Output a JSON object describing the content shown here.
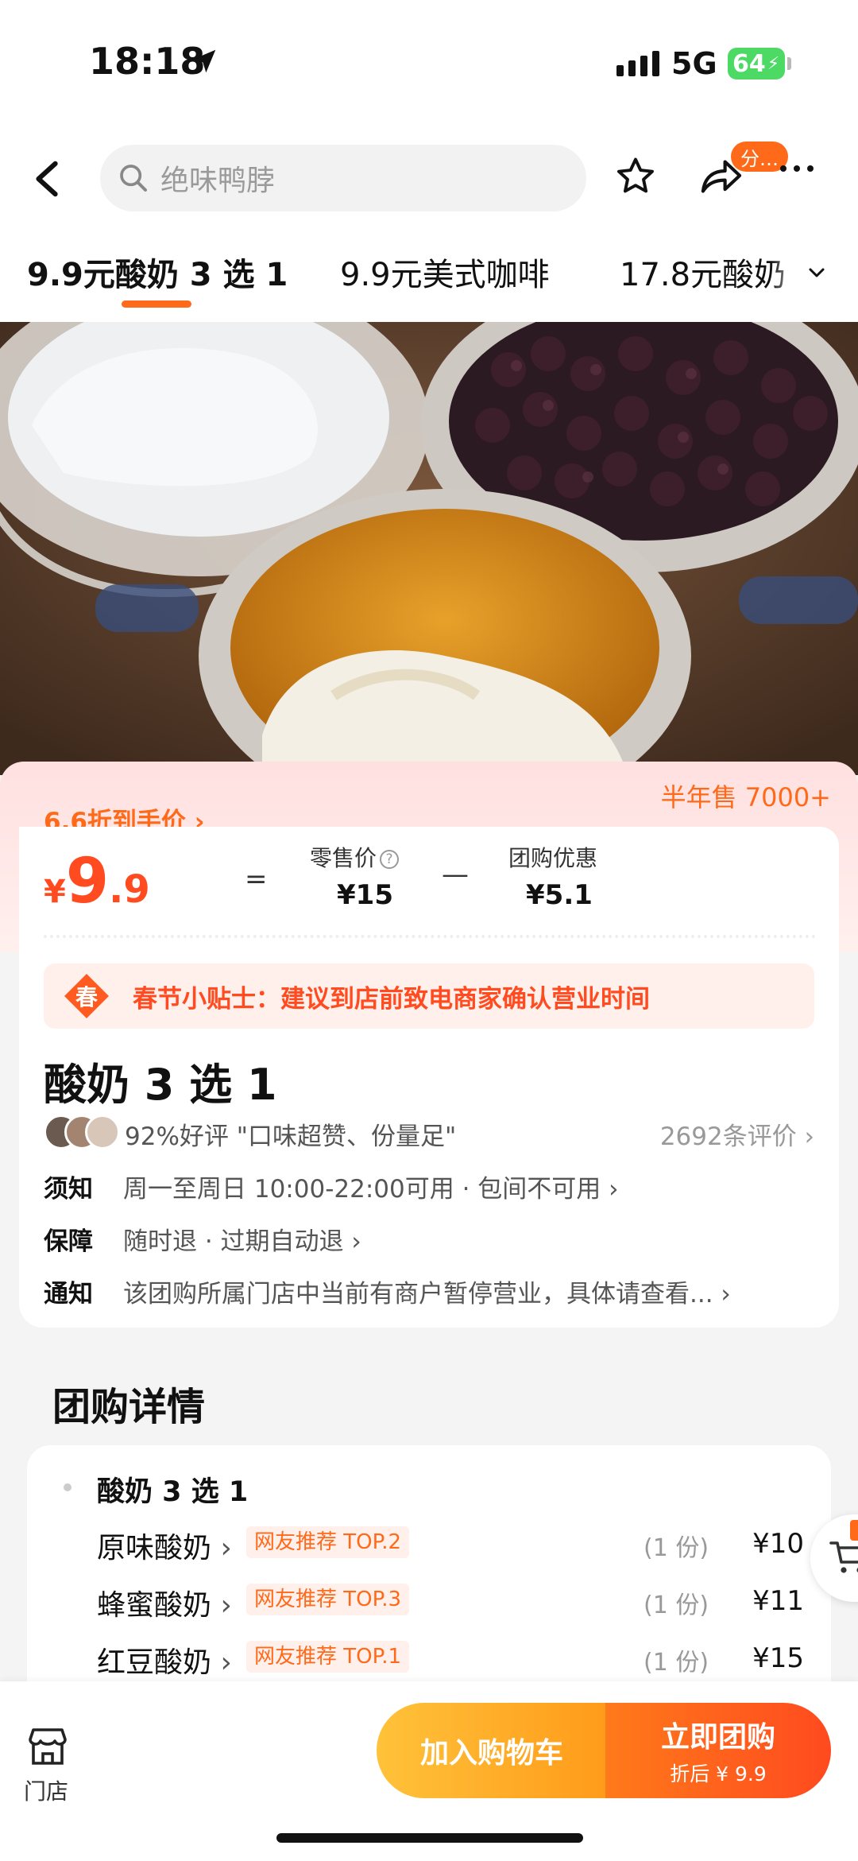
{
  "status": {
    "time": "18:18",
    "network": "5G",
    "battery": "64"
  },
  "header": {
    "search_placeholder": "绝味鸭脖",
    "share_badge": "分…"
  },
  "tabs": [
    {
      "label": "9.9元酸奶 3 选 1"
    },
    {
      "label": "9.9元美式咖啡"
    },
    {
      "label": "17.8元酸奶"
    }
  ],
  "price": {
    "discount_label": "6.6折到手价",
    "sales": "半年售 7000+",
    "currency": "¥",
    "integer": "9",
    "decimal": ".9",
    "equals": "=",
    "minus": "—",
    "retail_label": "零售价",
    "retail_value": "¥15",
    "group_label": "团购优惠",
    "group_value": "¥5.1"
  },
  "tip": {
    "badge": "春",
    "text": "春节小贴士：建议到店前致电商家确认营业时间"
  },
  "product": {
    "title": "酸奶 3 选 1"
  },
  "review": {
    "rating": "92%好评  \"口味超赞、份量足\"",
    "count": "2692条评价"
  },
  "info": [
    {
      "key": "须知",
      "value": "周一至周日 10:00-22:00可用 · 包间不可用"
    },
    {
      "key": "保障",
      "value": "随时退 · 过期自动退"
    },
    {
      "key": "通知",
      "value": "该团购所属门店中当前有商户暂停营业，具体请查看..."
    }
  ],
  "detail": {
    "heading": "团购详情",
    "group_name": "酸奶 3 选 1",
    "items": [
      {
        "name": "原味酸奶",
        "tag": "网友推荐 TOP.2",
        "qty": "(1 份)",
        "price": "¥10"
      },
      {
        "name": "蜂蜜酸奶",
        "tag": "网友推荐 TOP.3",
        "qty": "(1 份)",
        "price": "¥11"
      },
      {
        "name": "红豆酸奶",
        "tag": "网友推荐 TOP.1",
        "qty": "(1 份)",
        "price": "¥15"
      }
    ]
  },
  "bottom": {
    "store_label": "门店",
    "cart_label": "加入购物车",
    "buy_label": "立即团购",
    "buy_sub": "折后 ¥ 9.9"
  },
  "colors": {
    "accent": "#ff6a1a",
    "price": "#ff4b1f",
    "cart_btn": "#ffb02a",
    "buy_btn": "#ff5a1f"
  }
}
